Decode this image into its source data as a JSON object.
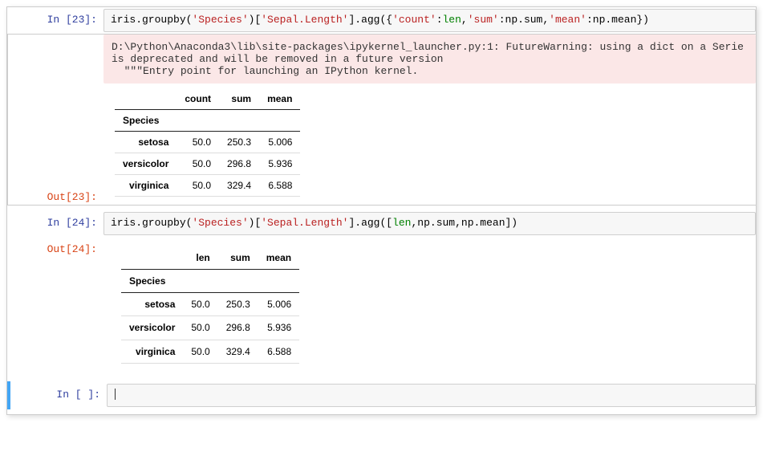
{
  "cells": {
    "c23": {
      "in_prompt": "In  [23]:",
      "code_parts": {
        "p0": "iris.groupby(",
        "p1": "'Species'",
        "p2": ")[",
        "p3": "'Sepal.Length'",
        "p4": "].agg({",
        "p5": "'count'",
        "p6": ":",
        "p7": "len",
        "p8": ",",
        "p9": "'sum'",
        "p10": ":np.sum,",
        "p11": "'mean'",
        "p12": ":np.mean})"
      },
      "out_prompt": "Out[23]:",
      "warning": "D:\\Python\\Anaconda3\\lib\\site-packages\\ipykernel_launcher.py:1: FutureWarning: using a dict on a Serie\nis deprecated and will be removed in a future version\n  \"\"\"Entry point for launching an IPython kernel.",
      "table": {
        "index_name": "Species",
        "columns": [
          "count",
          "sum",
          "mean"
        ],
        "rows": [
          {
            "idx": "setosa",
            "vals": [
              "50.0",
              "250.3",
              "5.006"
            ]
          },
          {
            "idx": "versicolor",
            "vals": [
              "50.0",
              "296.8",
              "5.936"
            ]
          },
          {
            "idx": "virginica",
            "vals": [
              "50.0",
              "329.4",
              "6.588"
            ]
          }
        ]
      }
    },
    "c24": {
      "in_prompt": "In  [24]:",
      "code_parts": {
        "p0": "iris.groupby(",
        "p1": "'Species'",
        "p2": ")[",
        "p3": "'Sepal.Length'",
        "p4": "].agg([",
        "p5": "len",
        "p6": ",np.sum,np.mean])"
      },
      "out_prompt": "Out[24]:",
      "table": {
        "index_name": "Species",
        "columns": [
          "len",
          "sum",
          "mean"
        ],
        "rows": [
          {
            "idx": "setosa",
            "vals": [
              "50.0",
              "250.3",
              "5.006"
            ]
          },
          {
            "idx": "versicolor",
            "vals": [
              "50.0",
              "296.8",
              "5.936"
            ]
          },
          {
            "idx": "virginica",
            "vals": [
              "50.0",
              "329.4",
              "6.588"
            ]
          }
        ]
      }
    },
    "empty": {
      "in_prompt": "In  [ ]:"
    }
  }
}
